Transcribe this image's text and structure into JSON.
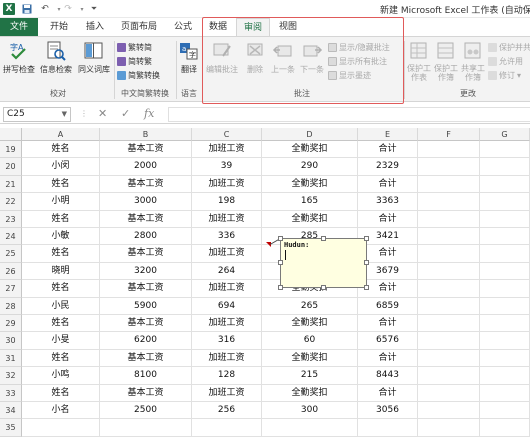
{
  "window": {
    "title": "新建 Microsoft Excel 工作表 (自动保存"
  },
  "quick_access": {
    "icons": [
      "excel-logo-icon",
      "save-icon",
      "undo-icon",
      "redo-icon",
      "customize-icon"
    ]
  },
  "tabs": [
    {
      "label": "文件"
    },
    {
      "label": "开始"
    },
    {
      "label": "插入"
    },
    {
      "label": "页面布局"
    },
    {
      "label": "公式"
    },
    {
      "label": "数据"
    },
    {
      "label": "审阅"
    },
    {
      "label": "视图"
    }
  ],
  "ribbon": {
    "proofing": {
      "spelling": "拼写检查",
      "research": "信息检索",
      "thesaurus": "同义词库",
      "group": "校对"
    },
    "chinese": {
      "to_simplified": "繁转简",
      "to_traditional": "简转繁",
      "convert": "简繁转换",
      "group": "中文简繁转换"
    },
    "language": {
      "translate": "翻译",
      "group": "语言"
    },
    "comments": {
      "edit": "编辑批注",
      "delete": "删除",
      "previous": "上一条",
      "next": "下一条",
      "show_hide": "显示/隐藏批注",
      "show_all": "显示所有批注",
      "show_ink": "显示墨迹",
      "group": "批注"
    },
    "changes": {
      "protect_sheet": "保护工作表",
      "protect_workbook": "保护工作簿",
      "share_workbook": "共享工作簿",
      "protect_share": "保护并共",
      "allow_edit": "允许用",
      "track": "修订",
      "group": "更改"
    }
  },
  "formula_bar": {
    "name_box": "C25",
    "cancel": "✕",
    "enter": "✓",
    "fx": "fx",
    "value": ""
  },
  "columns": [
    "A",
    "B",
    "C",
    "D",
    "E",
    "F",
    "G"
  ],
  "rows": [
    {
      "n": "19",
      "cells": [
        "姓名",
        "基本工资",
        "加班工资",
        "全勤奖扣",
        "合计"
      ]
    },
    {
      "n": "20",
      "cells": [
        "小闵",
        "2000",
        "39",
        "290",
        "2329"
      ]
    },
    {
      "n": "21",
      "cells": [
        "姓名",
        "基本工资",
        "加班工资",
        "全勤奖扣",
        "合计"
      ]
    },
    {
      "n": "22",
      "cells": [
        "小明",
        "3000",
        "198",
        "165",
        "3363"
      ]
    },
    {
      "n": "23",
      "cells": [
        "姓名",
        "基本工资",
        "加班工资",
        "全勤奖扣",
        "合计"
      ]
    },
    {
      "n": "24",
      "cells": [
        "小敏",
        "2800",
        "336",
        "285",
        "3421"
      ]
    },
    {
      "n": "25",
      "cells": [
        "姓名",
        "基本工资",
        "加班工资",
        "",
        "合计"
      ]
    },
    {
      "n": "26",
      "cells": [
        "晓明",
        "3200",
        "264",
        "",
        "3679"
      ]
    },
    {
      "n": "27",
      "cells": [
        "姓名",
        "基本工资",
        "加班工资",
        "全勤奖扣",
        "合计"
      ]
    },
    {
      "n": "28",
      "cells": [
        "小民",
        "5900",
        "694",
        "265",
        "6859"
      ]
    },
    {
      "n": "29",
      "cells": [
        "姓名",
        "基本工资",
        "加班工资",
        "全勤奖扣",
        "合计"
      ]
    },
    {
      "n": "30",
      "cells": [
        "小旻",
        "6200",
        "316",
        "60",
        "6576"
      ]
    },
    {
      "n": "31",
      "cells": [
        "姓名",
        "基本工资",
        "加班工资",
        "全勤奖扣",
        "合计"
      ]
    },
    {
      "n": "32",
      "cells": [
        "小鸣",
        "8100",
        "128",
        "215",
        "8443"
      ]
    },
    {
      "n": "33",
      "cells": [
        "姓名",
        "基本工资",
        "加班工资",
        "全勤奖扣",
        "合计"
      ]
    },
    {
      "n": "34",
      "cells": [
        "小名",
        "2500",
        "256",
        "300",
        "3056"
      ]
    },
    {
      "n": "35",
      "cells": [
        "",
        "",
        "",
        "",
        ""
      ]
    }
  ],
  "comment": {
    "author": "Hudun:"
  }
}
